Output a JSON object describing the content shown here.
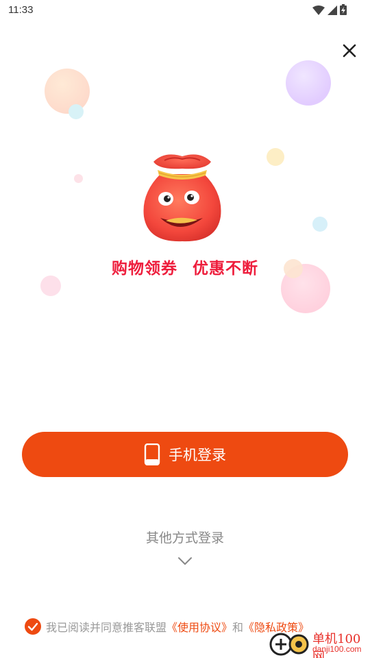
{
  "status_bar": {
    "time": "11:33",
    "icons": [
      "wifi-icon",
      "signal-icon",
      "battery-charging-icon"
    ]
  },
  "close_icon": "close-icon",
  "slogan": {
    "left": "购物领券",
    "right": "优惠不断"
  },
  "colors": {
    "accent": "#ee4a11",
    "slogan": "#ee1d3c",
    "mascot": "#f44a3f",
    "text_muted": "#999999"
  },
  "phone_login": {
    "icon": "phone-icon",
    "label": "手机登录"
  },
  "other_login": {
    "label": "其他方式登录",
    "icon": "chevron-down-icon"
  },
  "agreement": {
    "checked": true,
    "text": "我已阅读并同意推客联盟",
    "terms_link": "《使用协议》",
    "and": "和",
    "privacy_link": "《隐私政策》"
  },
  "watermark": {
    "line1": "单机100网",
    "line2": "danji100.com"
  }
}
